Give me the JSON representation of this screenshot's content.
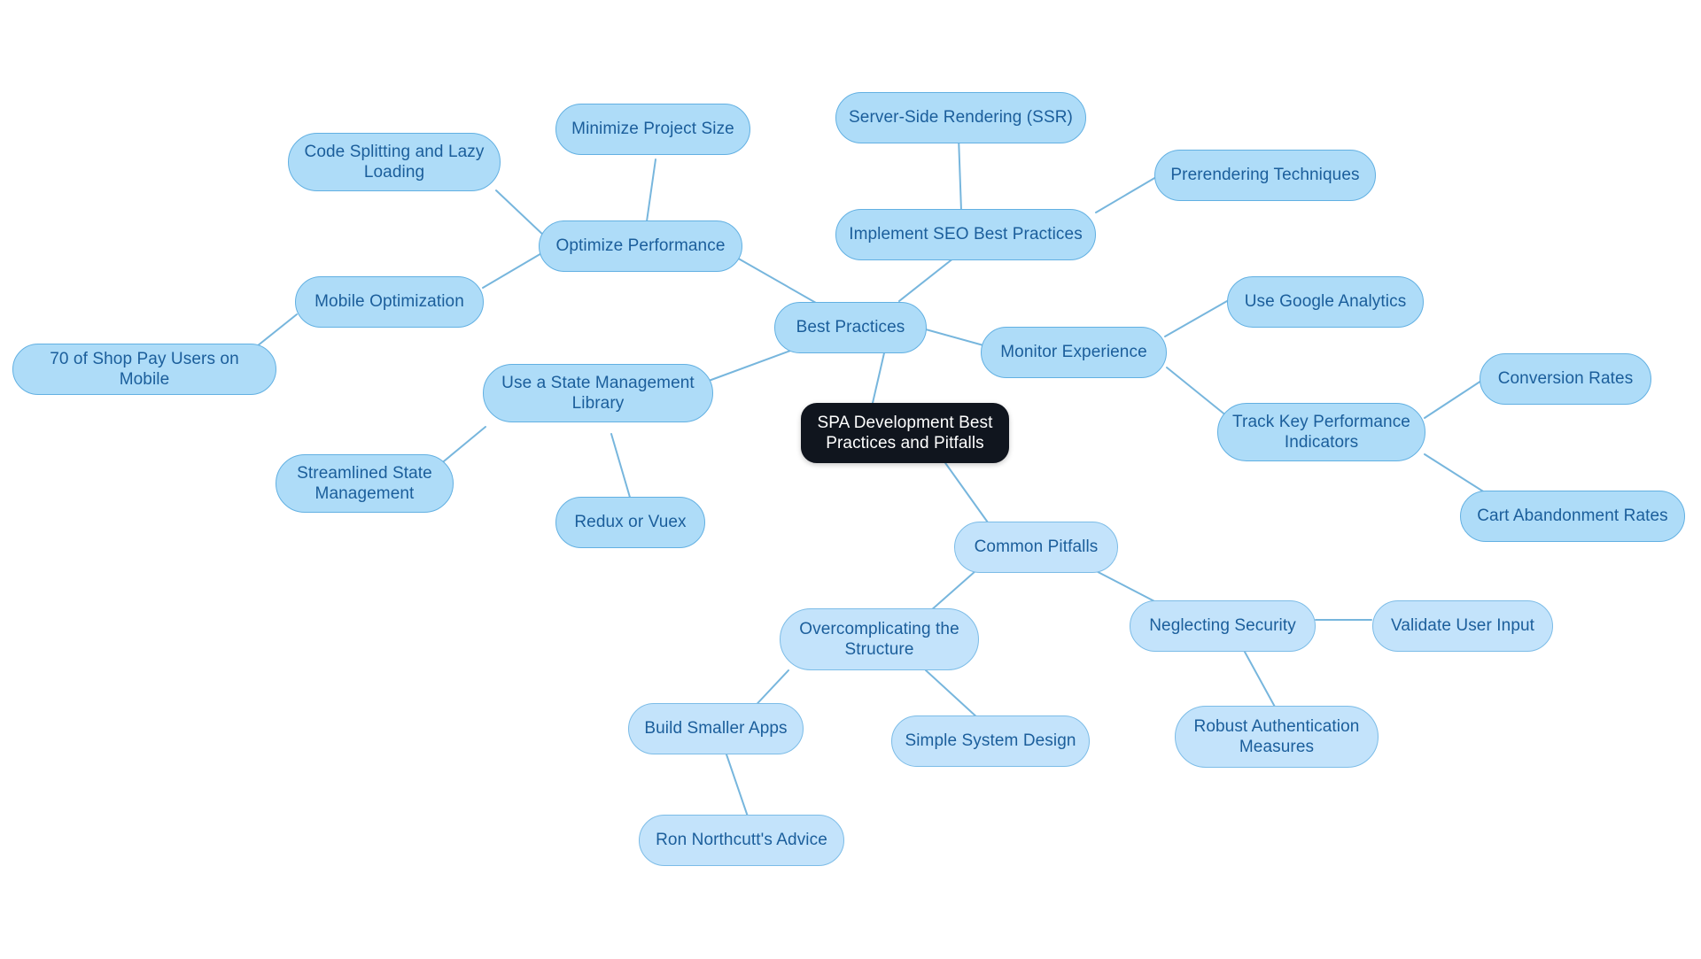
{
  "diagram": {
    "type": "mindmap",
    "title": "SPA Development Best Practices and Pitfalls",
    "colors": {
      "root_fill": "#10151e",
      "root_text": "#ffffff",
      "node_fill": "#aedcf8",
      "node_fill_soft": "#c3e3fb",
      "node_border": "#62b0e2",
      "node_text": "#1b5e9b",
      "edge": "#77b6dd",
      "background": "#ffffff"
    }
  },
  "nodes": {
    "root": {
      "label": "SPA Development Best\nPractices and Pitfalls"
    },
    "best_practices": {
      "label": "Best Practices"
    },
    "optimize_performance": {
      "label": "Optimize Performance"
    },
    "code_splitting": {
      "label": "Code Splitting and Lazy\nLoading"
    },
    "minimize_project_size": {
      "label": "Minimize Project Size"
    },
    "mobile_optimization": {
      "label": "Mobile Optimization"
    },
    "shop_pay_mobile": {
      "label": "70 of Shop Pay Users on Mobile"
    },
    "seo_best_practices": {
      "label": "Implement SEO Best Practices"
    },
    "ssr": {
      "label": "Server-Side Rendering (SSR)"
    },
    "prerendering": {
      "label": "Prerendering Techniques"
    },
    "monitor_experience": {
      "label": "Monitor Experience"
    },
    "google_analytics": {
      "label": "Use Google Analytics"
    },
    "track_kpis": {
      "label": "Track Key Performance\nIndicators"
    },
    "conversion_rates": {
      "label": "Conversion Rates"
    },
    "cart_abandonment": {
      "label": "Cart Abandonment Rates"
    },
    "state_management_library": {
      "label": "Use a State Management\nLibrary"
    },
    "streamlined_state": {
      "label": "Streamlined State\nManagement"
    },
    "redux_vuex": {
      "label": "Redux or Vuex"
    },
    "common_pitfalls": {
      "label": "Common Pitfalls"
    },
    "overcomplicating": {
      "label": "Overcomplicating the\nStructure"
    },
    "build_smaller_apps": {
      "label": "Build Smaller Apps"
    },
    "ron_northcutt": {
      "label": "Ron Northcutt's Advice"
    },
    "simple_system_design": {
      "label": "Simple System Design"
    },
    "neglecting_security": {
      "label": "Neglecting Security"
    },
    "validate_user_input": {
      "label": "Validate User Input"
    },
    "robust_authentication": {
      "label": "Robust Authentication\nMeasures"
    }
  },
  "edges": [
    {
      "from": "root",
      "to": "best_practices"
    },
    {
      "from": "root",
      "to": "common_pitfalls"
    },
    {
      "from": "best_practices",
      "to": "optimize_performance"
    },
    {
      "from": "best_practices",
      "to": "seo_best_practices"
    },
    {
      "from": "best_practices",
      "to": "monitor_experience"
    },
    {
      "from": "best_practices",
      "to": "state_management_library"
    },
    {
      "from": "optimize_performance",
      "to": "code_splitting"
    },
    {
      "from": "optimize_performance",
      "to": "minimize_project_size"
    },
    {
      "from": "optimize_performance",
      "to": "mobile_optimization"
    },
    {
      "from": "mobile_optimization",
      "to": "shop_pay_mobile"
    },
    {
      "from": "seo_best_practices",
      "to": "ssr"
    },
    {
      "from": "seo_best_practices",
      "to": "prerendering"
    },
    {
      "from": "monitor_experience",
      "to": "google_analytics"
    },
    {
      "from": "monitor_experience",
      "to": "track_kpis"
    },
    {
      "from": "track_kpis",
      "to": "conversion_rates"
    },
    {
      "from": "track_kpis",
      "to": "cart_abandonment"
    },
    {
      "from": "state_management_library",
      "to": "streamlined_state"
    },
    {
      "from": "state_management_library",
      "to": "redux_vuex"
    },
    {
      "from": "common_pitfalls",
      "to": "overcomplicating"
    },
    {
      "from": "common_pitfalls",
      "to": "neglecting_security"
    },
    {
      "from": "overcomplicating",
      "to": "build_smaller_apps"
    },
    {
      "from": "overcomplicating",
      "to": "simple_system_design"
    },
    {
      "from": "build_smaller_apps",
      "to": "ron_northcutt"
    },
    {
      "from": "neglecting_security",
      "to": "validate_user_input"
    },
    {
      "from": "neglecting_security",
      "to": "robust_authentication"
    }
  ]
}
